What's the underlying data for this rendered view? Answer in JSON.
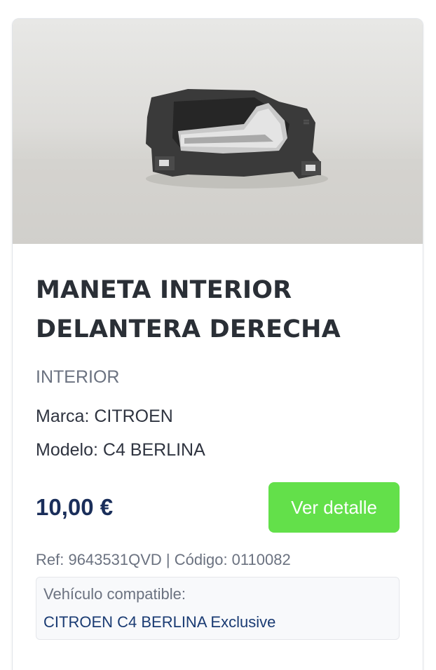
{
  "product": {
    "image_icon": "door-handle-photo",
    "title": "MANETA INTERIOR DELANTERA DERECHA",
    "category": "INTERIOR",
    "brand_text": "Marca: CITROEN",
    "model_text": "Modelo: C4 BERLINA",
    "price": "10,00 €",
    "button_label": "Ver detalle",
    "ref_text": "Ref: 9643531QVD | Código: 0110082",
    "compat_label": "Vehículo compatible:",
    "compat_vehicle": "CITROEN C4 BERLINA Exclusive"
  },
  "colors": {
    "button": "#63e04a",
    "price": "#1a2e5a",
    "link": "#1a3b73",
    "title": "#2a2f36"
  }
}
